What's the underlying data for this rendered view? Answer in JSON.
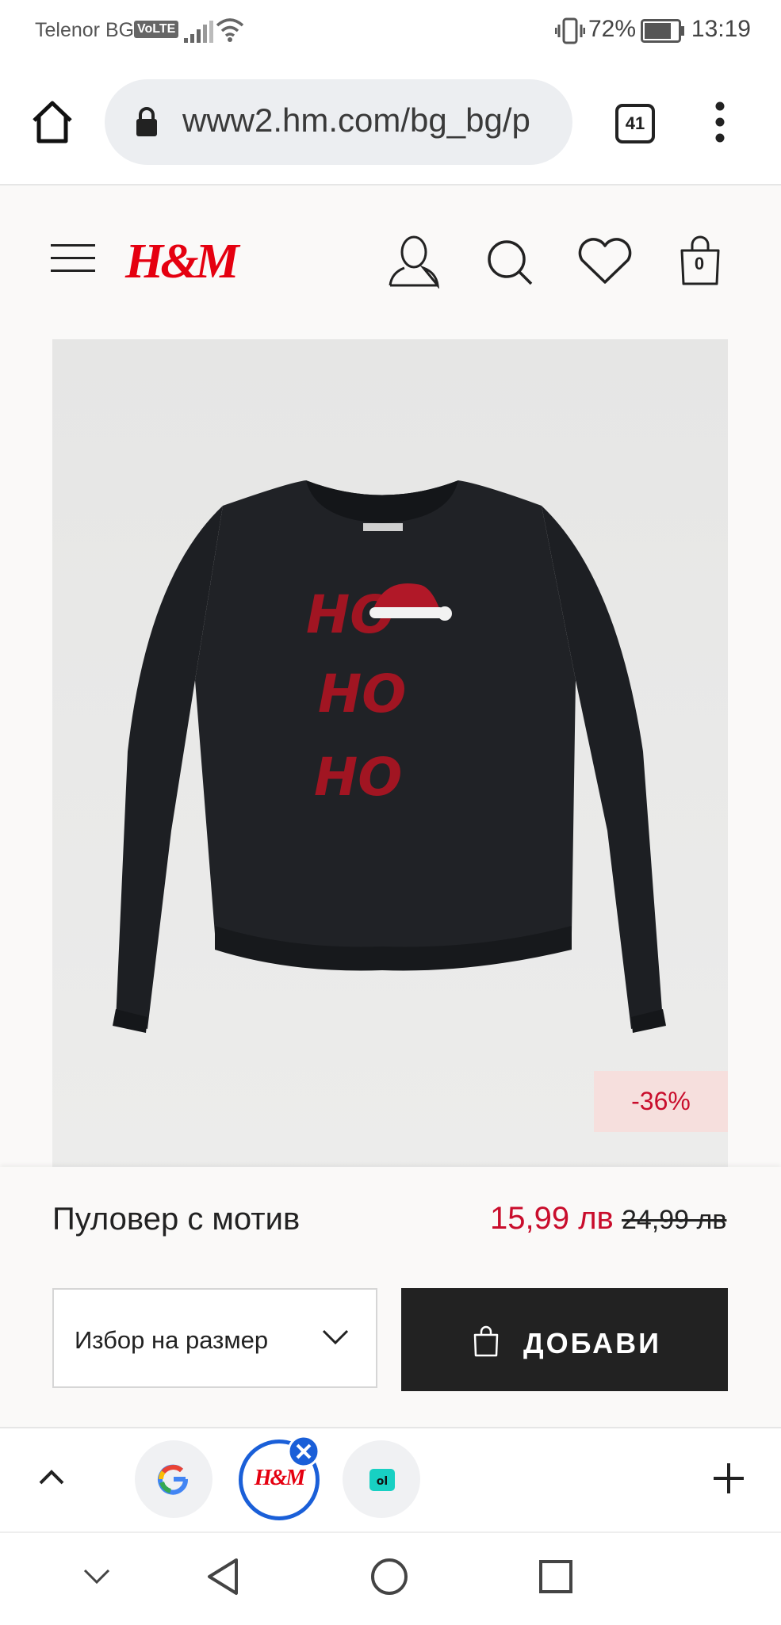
{
  "status_bar": {
    "carrier": "Telenor BG",
    "volte": "VoLTE",
    "battery": "72%",
    "time": "13:19"
  },
  "browser": {
    "url": "www2.hm.com/bg_bg/p",
    "tab_count": "41"
  },
  "site_header": {
    "logo": "H&M",
    "cart_count": "0"
  },
  "product": {
    "discount_badge": "-36%",
    "name": "Пуловер с мотив",
    "price_new": "15,99 лв",
    "price_old": "24,99 лв",
    "size_select_label": "Избор на размер",
    "add_button_label": "ДОБАВИ",
    "image_text": "HO HO HO"
  },
  "tab_strip": {
    "tabs": [
      "google-tab",
      "hm-tab",
      "other-tab"
    ],
    "hm_tab_label": "H&M"
  },
  "colors": {
    "brand_red": "#e50010",
    "price_red": "#c90d2c",
    "button_dark": "#222222",
    "active_tab_ring": "#1a5fd8"
  }
}
